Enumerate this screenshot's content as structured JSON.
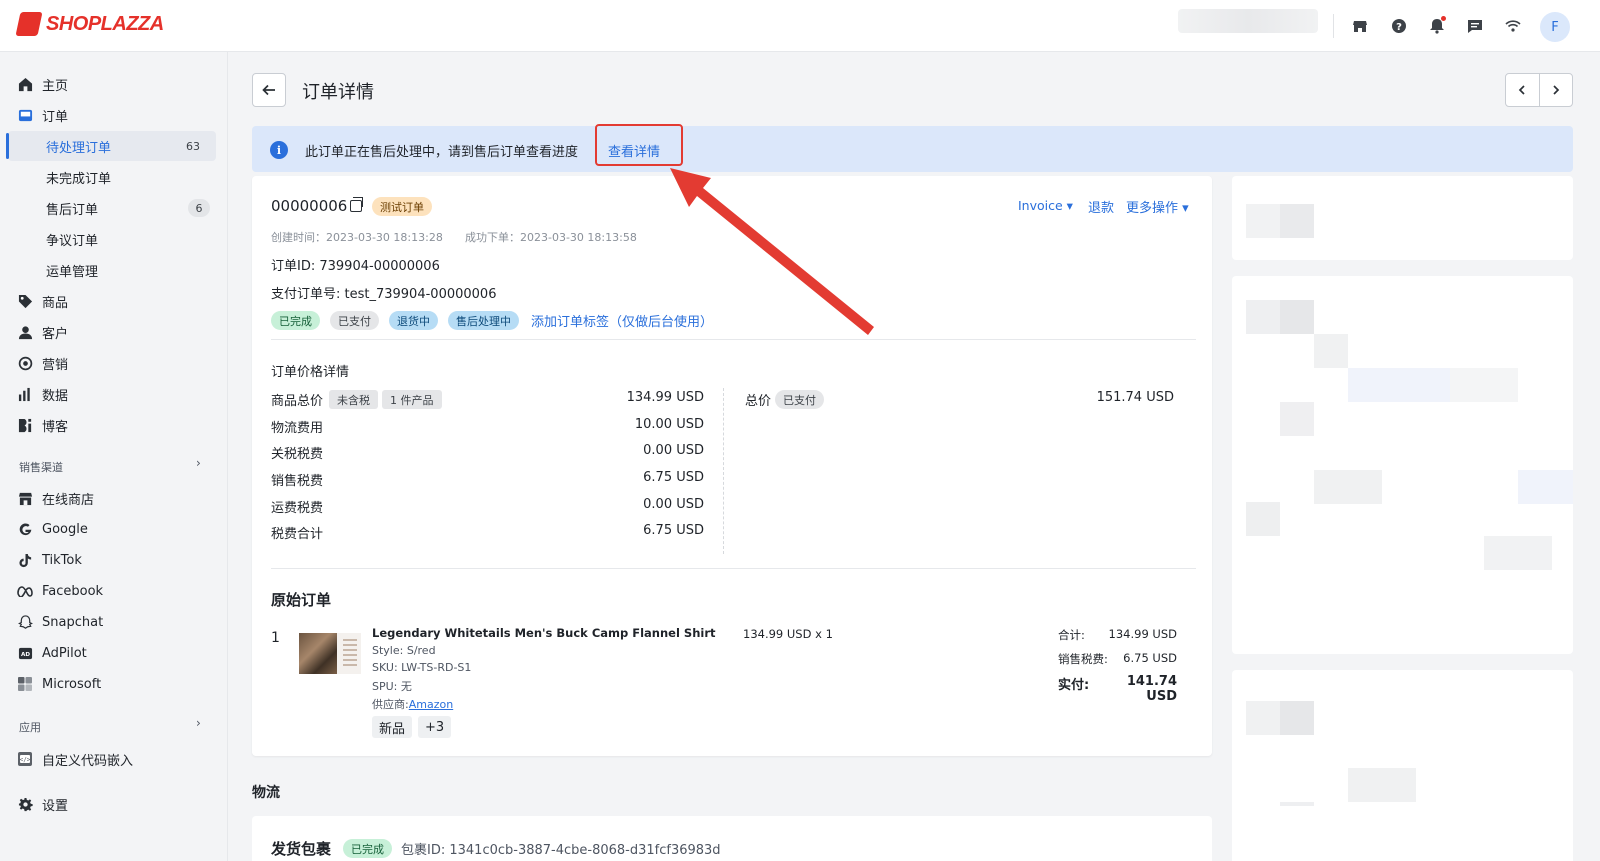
{
  "brand": {
    "name": "SHOPLAZZA",
    "color": "#e5312a"
  },
  "topbar": {
    "icons": [
      "store-icon",
      "help-icon",
      "bell-icon",
      "message-icon",
      "wifi-icon"
    ],
    "avatar": "F"
  },
  "sidebar": {
    "items": [
      {
        "label": "主页",
        "icon": "home-icon"
      },
      {
        "label": "订单",
        "icon": "inbox-icon"
      },
      {
        "label": "商品",
        "icon": "tag-icon"
      },
      {
        "label": "客户",
        "icon": "person-icon"
      },
      {
        "label": "营销",
        "icon": "target-icon"
      },
      {
        "label": "数据",
        "icon": "bar-chart-icon"
      },
      {
        "label": "博客",
        "icon": "blog-icon"
      }
    ],
    "order_sub": [
      {
        "label": "待处理订单",
        "count": "63",
        "active": true
      },
      {
        "label": "未完成订单"
      },
      {
        "label": "售后订单",
        "count": "6"
      },
      {
        "label": "争议订单"
      },
      {
        "label": "运单管理"
      }
    ],
    "sales_channels_title": "销售渠道",
    "channels": [
      {
        "label": "在线商店",
        "icon": "store-icon"
      },
      {
        "label": "Google",
        "icon": "google-icon"
      },
      {
        "label": "TikTok",
        "icon": "tiktok-icon"
      },
      {
        "label": "Facebook",
        "icon": "meta-icon"
      },
      {
        "label": "Snapchat",
        "icon": "ghost-icon"
      },
      {
        "label": "AdPilot",
        "icon": "ad-icon"
      },
      {
        "label": "Microsoft",
        "icon": "windows-icon"
      }
    ],
    "apps_title": "应用",
    "apps": [
      {
        "label": "自定义代码嵌入",
        "icon": "code-icon"
      }
    ],
    "settings": {
      "label": "设置",
      "icon": "gear-icon"
    }
  },
  "header": {
    "title": "订单详情"
  },
  "banner": {
    "text": "此订单正在售后处理中，请到售后订单查看进度",
    "link": "查看详情",
    "accent": "#2a6fdb"
  },
  "order": {
    "number": "00000006",
    "test_tag": "测试订单",
    "actions": {
      "invoice": "Invoice ▾",
      "refund": "退款",
      "more": "更多操作 ▾"
    },
    "created": "创建时间：2023-03-30 18:13:28",
    "placed": "成功下单：2023-03-30 18:13:58",
    "order_id": "订单ID: 739904-00000006",
    "payment_no": "支付订单号: test_739904-00000006",
    "status_tags": [
      "已完成",
      "已支付",
      "退货中",
      "售后处理中"
    ],
    "add_tag_link": "添加订单标签（仅做后台使用）"
  },
  "price": {
    "title": "订单价格详情",
    "subtotal_label": "商品总价",
    "tax_excl": "未含税",
    "item_count": "1 件产品",
    "rows": [
      {
        "label": "商品总价",
        "value": "134.99 USD"
      },
      {
        "label": "物流费用",
        "value": "10.00 USD"
      },
      {
        "label": "关税税费",
        "value": "0.00 USD"
      },
      {
        "label": "销售税费",
        "value": "6.75 USD"
      },
      {
        "label": "运费税费",
        "value": "0.00 USD"
      },
      {
        "label": "税费合计",
        "value": "6.75 USD"
      }
    ],
    "total_label": "总价",
    "total_status": "已支付",
    "total_value": "151.74 USD"
  },
  "original": {
    "title": "原始订单",
    "index": "1",
    "product": {
      "name": "Legendary Whitetails Men's Buck Camp Flannel Shirt",
      "style": "Style: S/red",
      "sku": "SKU: LW-TS-RD-S1",
      "spu": "SPU: 无",
      "supplier_prefix": "供应商:",
      "supplier": "Amazon",
      "chips": [
        "新品",
        "+3"
      ],
      "unit_price": "134.99 USD x 1",
      "subtotal_label": "合计:",
      "subtotal": "134.99 USD",
      "tax_label": "销售税费:",
      "tax": "6.75 USD",
      "paid_label": "实付:",
      "paid": "141.74 USD"
    }
  },
  "logistics": {
    "title": "物流",
    "package_title": "发货包裹",
    "package_status": "已完成",
    "package_id": "包裹ID: 1341c0cb-3887-4cbe-8068-d31fcf36983d"
  },
  "annotation": {
    "color": "#e33b32"
  }
}
